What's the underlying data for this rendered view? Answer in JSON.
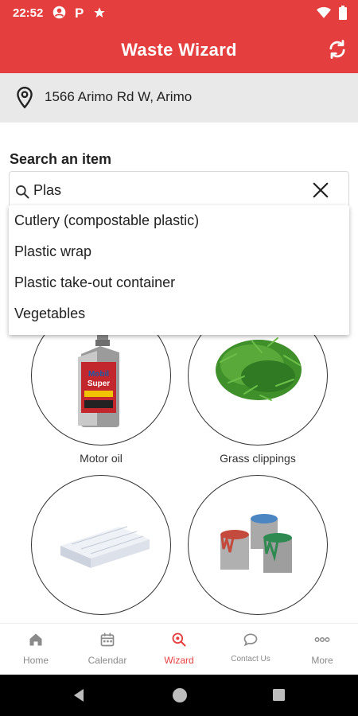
{
  "status_bar": {
    "time": "22:52"
  },
  "app": {
    "title": "Waste Wizard"
  },
  "address": {
    "text": "1566 Arimo Rd W, Arimo"
  },
  "search": {
    "label": "Search an item",
    "query": "Plas",
    "suggestions": [
      "Cutlery (compostable plastic)",
      "Plastic wrap",
      "Plastic take-out container",
      "Vegetables"
    ]
  },
  "items": [
    {
      "name": "Motor oil"
    },
    {
      "name": "Grass clippings"
    },
    {
      "name": ""
    },
    {
      "name": ""
    }
  ],
  "bottom_nav": {
    "items": [
      {
        "label": "Home",
        "icon": "home-icon"
      },
      {
        "label": "Calendar",
        "icon": "calendar-icon"
      },
      {
        "label": "Wizard",
        "icon": "wizard-icon"
      },
      {
        "label": "Contact Us",
        "icon": "chat-icon"
      },
      {
        "label": "More",
        "icon": "more-icon"
      }
    ],
    "active_index": 2
  },
  "colors": {
    "brand": "#e53e3e",
    "inactive": "#8a8a8a",
    "address_bg": "#e9e9e9"
  }
}
